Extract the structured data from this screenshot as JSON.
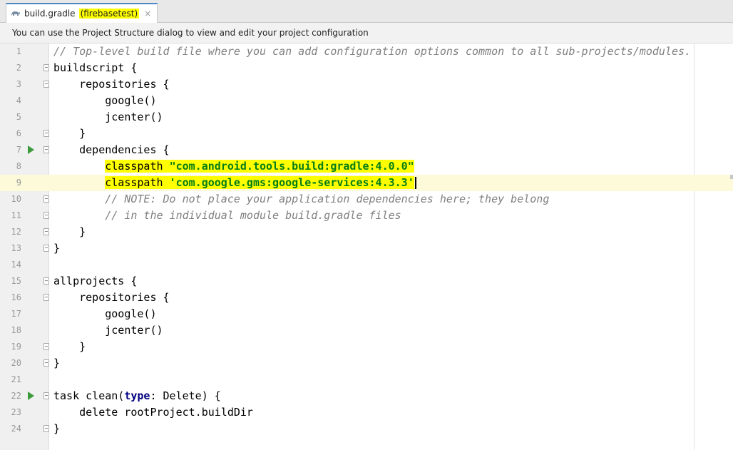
{
  "tab": {
    "file_name": "build.gradle",
    "module_name": "(firebasetest)",
    "close_glyph": "×",
    "icon": "gradle-elephant-icon"
  },
  "notice": {
    "text": "You can use the Project Structure dialog to view and edit your project configuration"
  },
  "editor": {
    "current_line": 9,
    "lines": [
      {
        "n": "1",
        "text": "// Top-level build file where you can add configuration options common to all sub-projects/modules."
      },
      {
        "n": "2",
        "text": "buildscript {"
      },
      {
        "n": "3",
        "text": "    repositories {"
      },
      {
        "n": "4",
        "text": "        google()"
      },
      {
        "n": "5",
        "text": "        jcenter()"
      },
      {
        "n": "6",
        "text": "    }"
      },
      {
        "n": "7",
        "text": "    dependencies {"
      },
      {
        "n": "8",
        "prefix": "        classpath ",
        "string": "\"com.android.tools.build:gradle:4.0.0\""
      },
      {
        "n": "9",
        "prefix": "        classpath ",
        "string": "'com.google.gms:google-services:4.3.3'"
      },
      {
        "n": "10",
        "text": "        // NOTE: Do not place your application dependencies here; they belong"
      },
      {
        "n": "11",
        "text": "        // in the individual module build.gradle files"
      },
      {
        "n": "12",
        "text": "    }"
      },
      {
        "n": "13",
        "text": "}"
      },
      {
        "n": "14",
        "text": ""
      },
      {
        "n": "15",
        "text": "allprojects {"
      },
      {
        "n": "16",
        "text": "    repositories {"
      },
      {
        "n": "17",
        "text": "        google()"
      },
      {
        "n": "18",
        "text": "        jcenter()"
      },
      {
        "n": "19",
        "text": "    }"
      },
      {
        "n": "20",
        "text": "}"
      },
      {
        "n": "21",
        "text": ""
      },
      {
        "n": "22",
        "prefix": "task clean(",
        "keyword": "type",
        "suffix": ": Delete) {"
      },
      {
        "n": "23",
        "text": "    delete rootProject.buildDir"
      },
      {
        "n": "24",
        "text": "}"
      }
    ]
  },
  "colors": {
    "string": "#067d17",
    "keyword": "#000080",
    "comment": "#808080",
    "highlight": "#ffff00",
    "current_line": "#fcfad9",
    "run_icon": "#3c9a3c"
  }
}
